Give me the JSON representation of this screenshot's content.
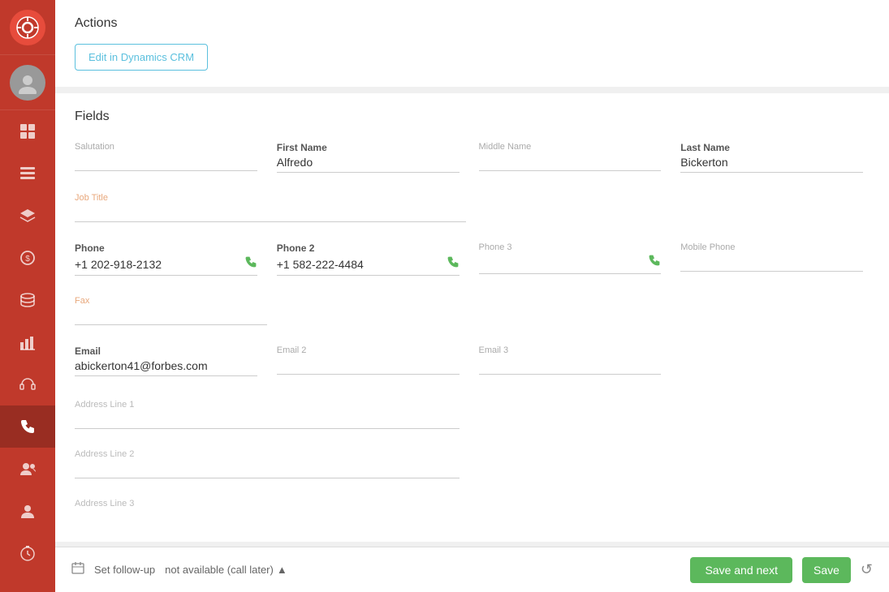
{
  "sidebar": {
    "logo_icon": "🎬",
    "items": [
      {
        "name": "dashboard",
        "icon": "⊞",
        "active": false
      },
      {
        "name": "inbox",
        "icon": "▤",
        "active": false
      },
      {
        "name": "layers",
        "icon": "◫",
        "active": false
      },
      {
        "name": "coins",
        "icon": "◎",
        "active": false
      },
      {
        "name": "database",
        "icon": "⊟",
        "active": false
      },
      {
        "name": "chart",
        "icon": "▦",
        "active": false
      },
      {
        "name": "headset",
        "icon": "⊙",
        "active": false
      },
      {
        "name": "phone",
        "icon": "✆",
        "active": true
      },
      {
        "name": "users-gear",
        "icon": "⚙",
        "active": false
      },
      {
        "name": "person",
        "icon": "👤",
        "active": false
      },
      {
        "name": "timer",
        "icon": "⏱",
        "active": false
      }
    ]
  },
  "actions": {
    "title": "Actions",
    "edit_btn_label": "Edit in Dynamics CRM"
  },
  "fields": {
    "title": "Fields",
    "salutation_label": "Salutation",
    "salutation_value": "",
    "first_name_label": "First Name",
    "first_name_value": "Alfredo",
    "middle_name_label": "Middle Name",
    "middle_name_value": "",
    "last_name_label": "Last Name",
    "last_name_value": "Bickerton",
    "job_title_label": "Job Title",
    "job_title_value": "",
    "phone_label": "Phone",
    "phone_value": "+1 202-918-2132",
    "phone2_label": "Phone 2",
    "phone2_value": "+1 582-222-4484",
    "phone3_label": "Phone 3",
    "phone3_value": "",
    "mobile_phone_label": "Mobile Phone",
    "mobile_phone_value": "",
    "fax_label": "Fax",
    "fax_value": "",
    "email_label": "Email",
    "email_value": "abickerton41@forbes.com",
    "email2_label": "Email 2",
    "email2_value": "",
    "email3_label": "Email 3",
    "email3_value": "",
    "address1_label": "Address Line 1",
    "address1_value": "",
    "address2_label": "Address Line 2",
    "address2_value": "",
    "address3_label": "Address Line 3",
    "address3_value": ""
  },
  "bottom_bar": {
    "follow_up_label": "Set follow-up",
    "follow_up_value": "not available (call later)",
    "save_next_label": "Save and next",
    "save_label": "Save",
    "reset_icon": "↺"
  }
}
